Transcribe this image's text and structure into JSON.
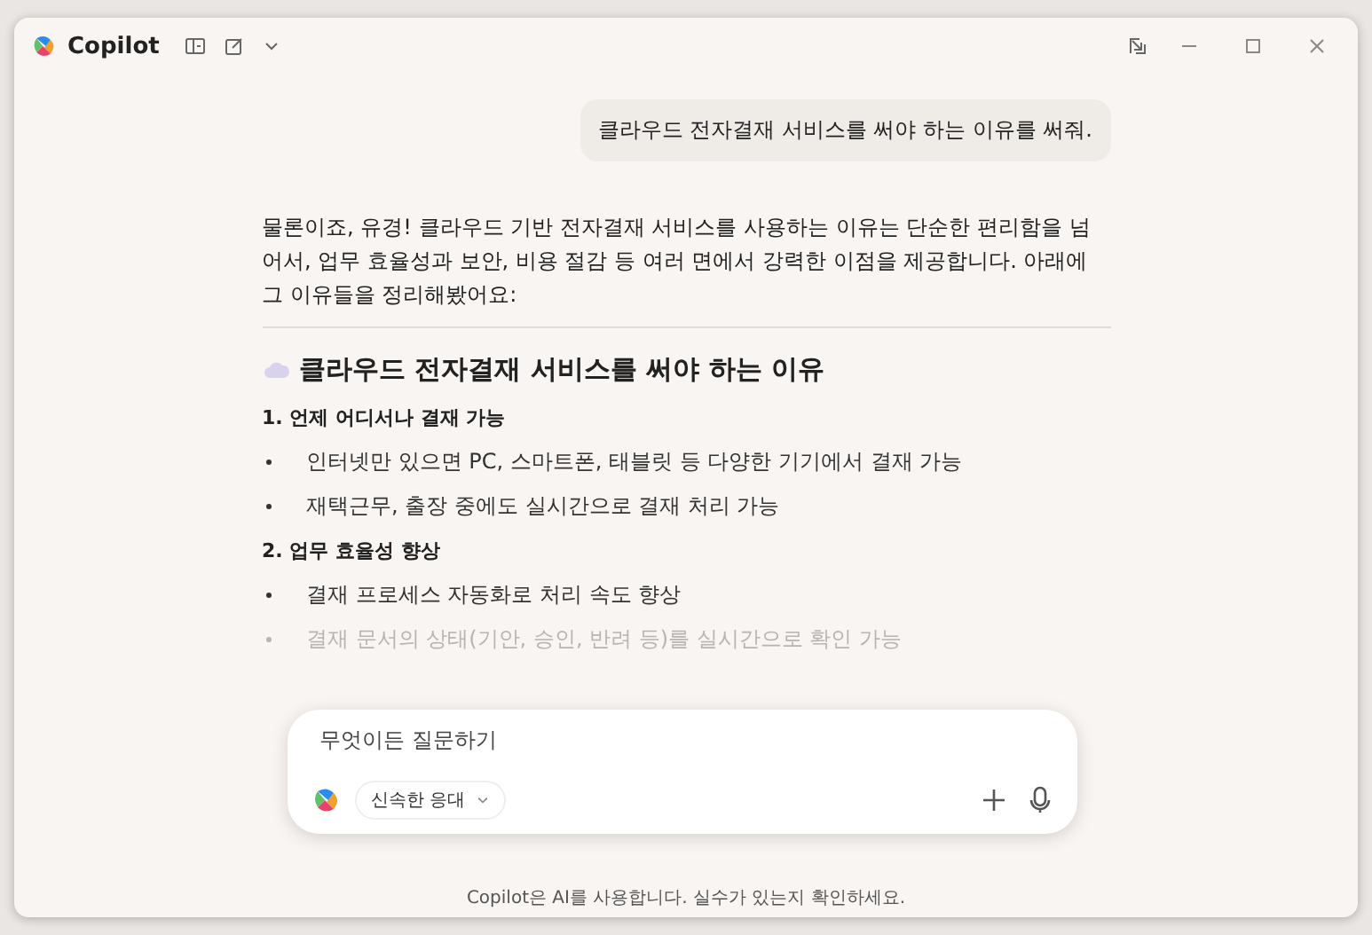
{
  "app": {
    "name": "Copilot"
  },
  "user_message": "클라우드 전자결재 서비스를 써야 하는 이유를 써줘.",
  "reply": {
    "intro": "물론이죠, 유경! 클라우드 기반 전자결재 서비스를 사용하는 이유는 단순한 편리함을 넘어서, 업무 효율성과 보안, 비용 절감 등 여러 면에서 강력한 이점을 제공합니다. 아래에 그 이유들을 정리해봤어요:",
    "heading": "클라우드 전자결재 서비스를 써야 하는 이유",
    "sections": [
      {
        "title": "1. 언제 어디서나 결재 가능",
        "items": [
          {
            "text": "인터넷만 있으면 PC, 스마트폰, 태블릿 등 다양한 기기에서 결재 가능",
            "faded": false
          },
          {
            "text": "재택근무, 출장 중에도 실시간으로 결재 처리 가능",
            "faded": false
          }
        ]
      },
      {
        "title": "2. 업무 효율성 향상",
        "items": [
          {
            "text": "결재 프로세스 자동화로 처리 속도 향상",
            "faded": false
          },
          {
            "text": "결재 문서의 상태(기안, 승인, 반려 등)를 실시간으로 확인 가능",
            "faded": true
          }
        ]
      }
    ]
  },
  "composer": {
    "placeholder": "무엇이든 질문하기",
    "mode": "신속한 응대"
  },
  "footer": "Copilot은 AI를 사용합니다. 실수가 있는지 확인하세요."
}
